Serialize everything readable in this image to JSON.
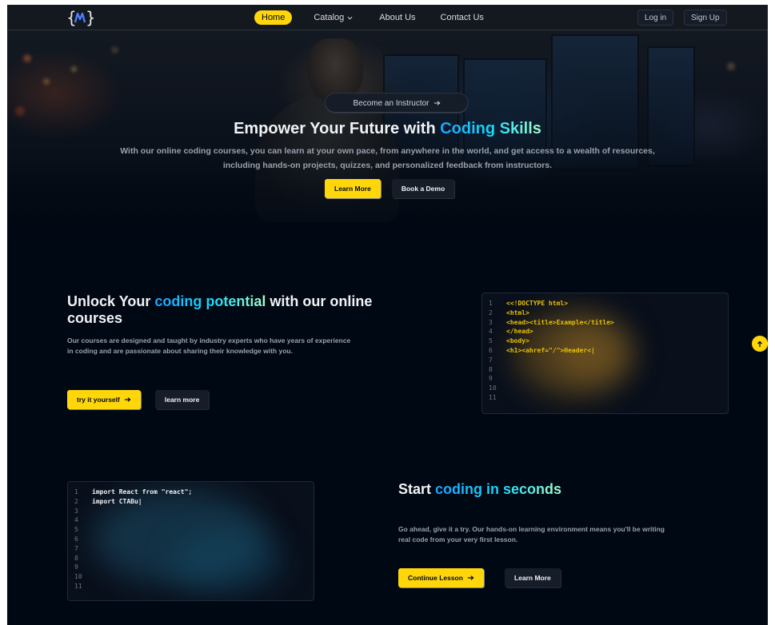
{
  "nav": {
    "links": [
      {
        "label": "Home",
        "active": true
      },
      {
        "label": "Catalog",
        "active": false
      },
      {
        "label": "About Us",
        "active": false
      },
      {
        "label": "Contact Us",
        "active": false
      }
    ],
    "login_label": "Log in",
    "signup_label": "Sign Up"
  },
  "hero": {
    "pill_label": "Become an Instructor",
    "title_prefix": "Empower Your Future with ",
    "title_highlight": "Coding Skills",
    "subtitle": "With our online coding courses, you can learn at your own pace, from anywhere in the world, and get access to a wealth of resources, including hands-on projects, quizzes, and personalized feedback from instructors.",
    "primary_button": "Learn More",
    "secondary_button": "Book a Demo"
  },
  "section1": {
    "title_prefix": "Unlock Your ",
    "title_highlight": "coding potential",
    "title_suffix": " with our online courses",
    "description": "Our courses are designed and taught by industry experts who have years of experience in coding and are passionate about sharing their knowledge with you.",
    "primary_button": "try it yourself",
    "secondary_button": "learn more",
    "code_lines": [
      {
        "n": "1",
        "text": "<<!DOCTYPE html>"
      },
      {
        "n": "2",
        "text": "<html>"
      },
      {
        "n": "3",
        "text": "<head><title>Example</title>"
      },
      {
        "n": "4",
        "text": "</head>"
      },
      {
        "n": "5",
        "text": "<body>"
      },
      {
        "n": "6",
        "text": "<h1><ahref=\"/\">Header<|"
      },
      {
        "n": "7",
        "text": ""
      },
      {
        "n": "8",
        "text": ""
      },
      {
        "n": "9",
        "text": ""
      },
      {
        "n": "10",
        "text": ""
      },
      {
        "n": "11",
        "text": ""
      }
    ]
  },
  "section2": {
    "title_prefix": "Start ",
    "title_highlight": "coding in seconds",
    "description": "Go ahead, give it a try. Our hands-on learning environment means you'll be writing real code from your very first lesson.",
    "primary_button": "Continue Lesson",
    "secondary_button": "Learn More",
    "code_lines": [
      {
        "n": "1",
        "text": "import React from \"react\";"
      },
      {
        "n": "2",
        "text": "import CTABu|"
      },
      {
        "n": "3",
        "text": ""
      },
      {
        "n": "4",
        "text": ""
      },
      {
        "n": "5",
        "text": ""
      },
      {
        "n": "6",
        "text": ""
      },
      {
        "n": "7",
        "text": ""
      },
      {
        "n": "8",
        "text": ""
      },
      {
        "n": "9",
        "text": ""
      },
      {
        "n": "10",
        "text": ""
      },
      {
        "n": "11",
        "text": ""
      }
    ]
  },
  "colors": {
    "accent_yellow": "#ffd60a",
    "background": "#000814",
    "highlight_gradient": [
      "#1fa2ff",
      "#12d8fa",
      "#a6ffcb"
    ]
  },
  "icons": {
    "logo": "curly-brace-logo-icon",
    "catalog": "chevron-down-icon",
    "arrow": "arrow-right-icon",
    "scroll_top": "arrow-up-icon"
  }
}
